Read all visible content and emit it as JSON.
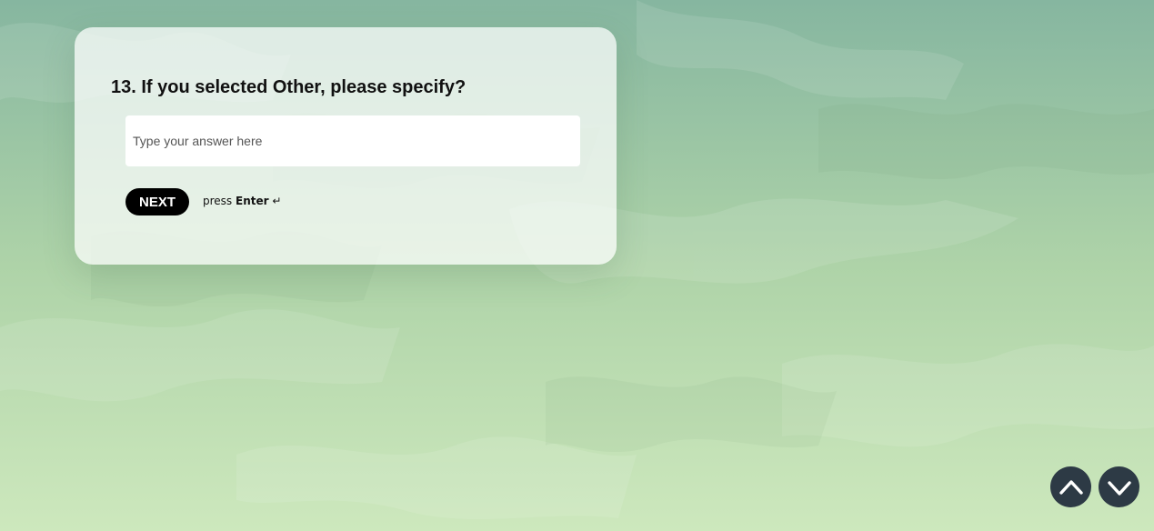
{
  "colors": {
    "background_top": "#86b6a0",
    "background_bottom": "#cde8bd",
    "button": "#000000",
    "nav_button": "#2d3a45"
  },
  "question": {
    "text": "13. If you selected Other, please specify?"
  },
  "answer": {
    "placeholder": "Type your answer here",
    "value": ""
  },
  "actions": {
    "next_label": "NEXT",
    "hint_prefix": "press",
    "hint_key": "Enter",
    "hint_icon": "↵"
  },
  "navigation": {
    "up_icon": "chevron-up-icon",
    "down_icon": "chevron-down-icon"
  }
}
